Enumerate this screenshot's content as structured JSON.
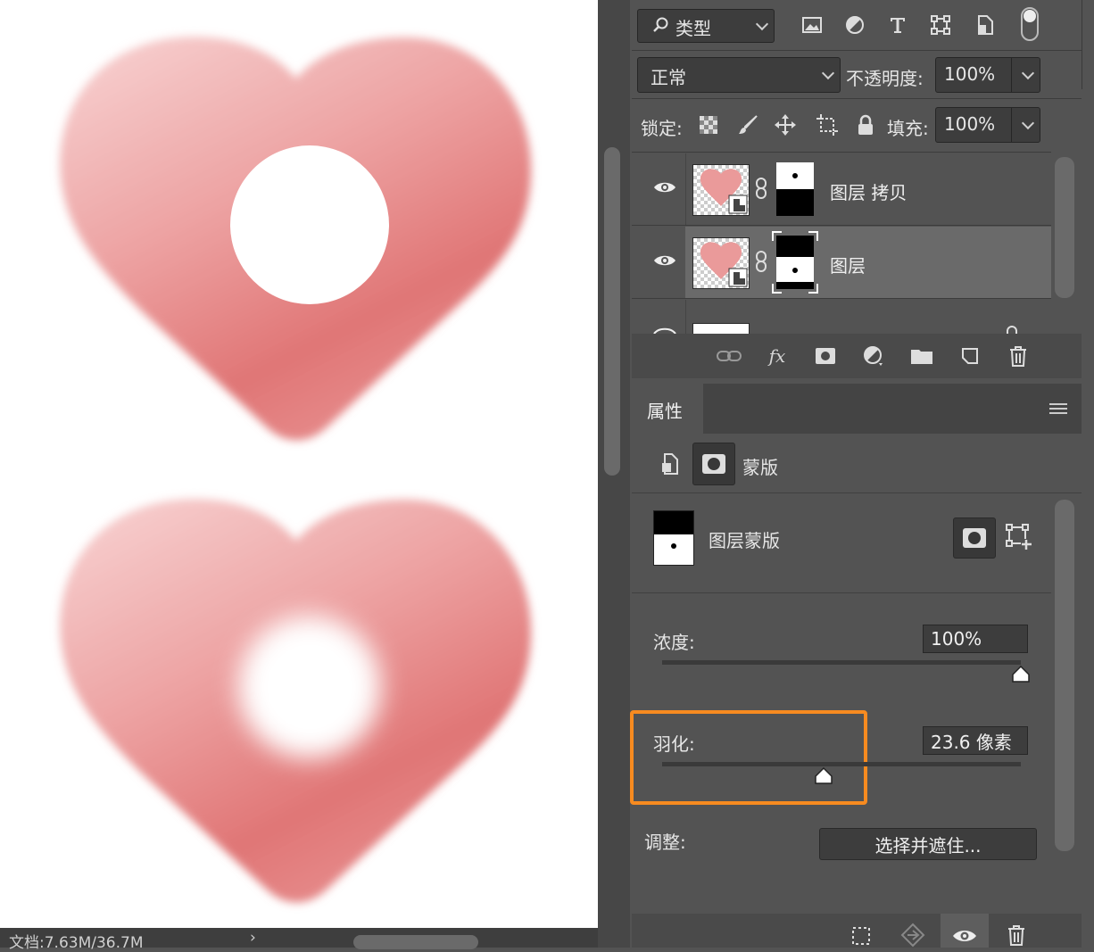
{
  "status": {
    "doc_info": "文档:7.63M/36.7M",
    "arrow": "›"
  },
  "layers_panel": {
    "filter_type": "类型",
    "blend_mode": "正常",
    "opacity_label": "不透明度:",
    "opacity_value": "100%",
    "lock_label": "锁定:",
    "fill_label": "填充:",
    "fill_value": "100%",
    "layers": [
      {
        "name": "图层 拷贝",
        "selected": false,
        "visible": true
      },
      {
        "name": "图层",
        "selected": true,
        "visible": true
      }
    ],
    "bottom_buttons": [
      "link-icon",
      "fx-icon",
      "add-mask-icon",
      "adjustment-icon",
      "folder-icon",
      "new-layer-icon",
      "trash-icon"
    ],
    "fx_glyph": "fx"
  },
  "properties": {
    "title": "属性",
    "mask_tab_label": "蒙版",
    "layer_mask_label": "图层蒙版",
    "density_label": "浓度:",
    "density_value": "100%",
    "density_level": 1.0,
    "feather_label": "羽化:",
    "feather_value": "23.6 像素",
    "feather_level": 0.45,
    "adjust_label": "调整:",
    "refine_button": "选择并遮住..."
  },
  "colors": {
    "highlight": "#f78b20",
    "heart_light": "#f6cdcd",
    "heart_dark": "#e07474",
    "panel_bg": "#535353"
  }
}
